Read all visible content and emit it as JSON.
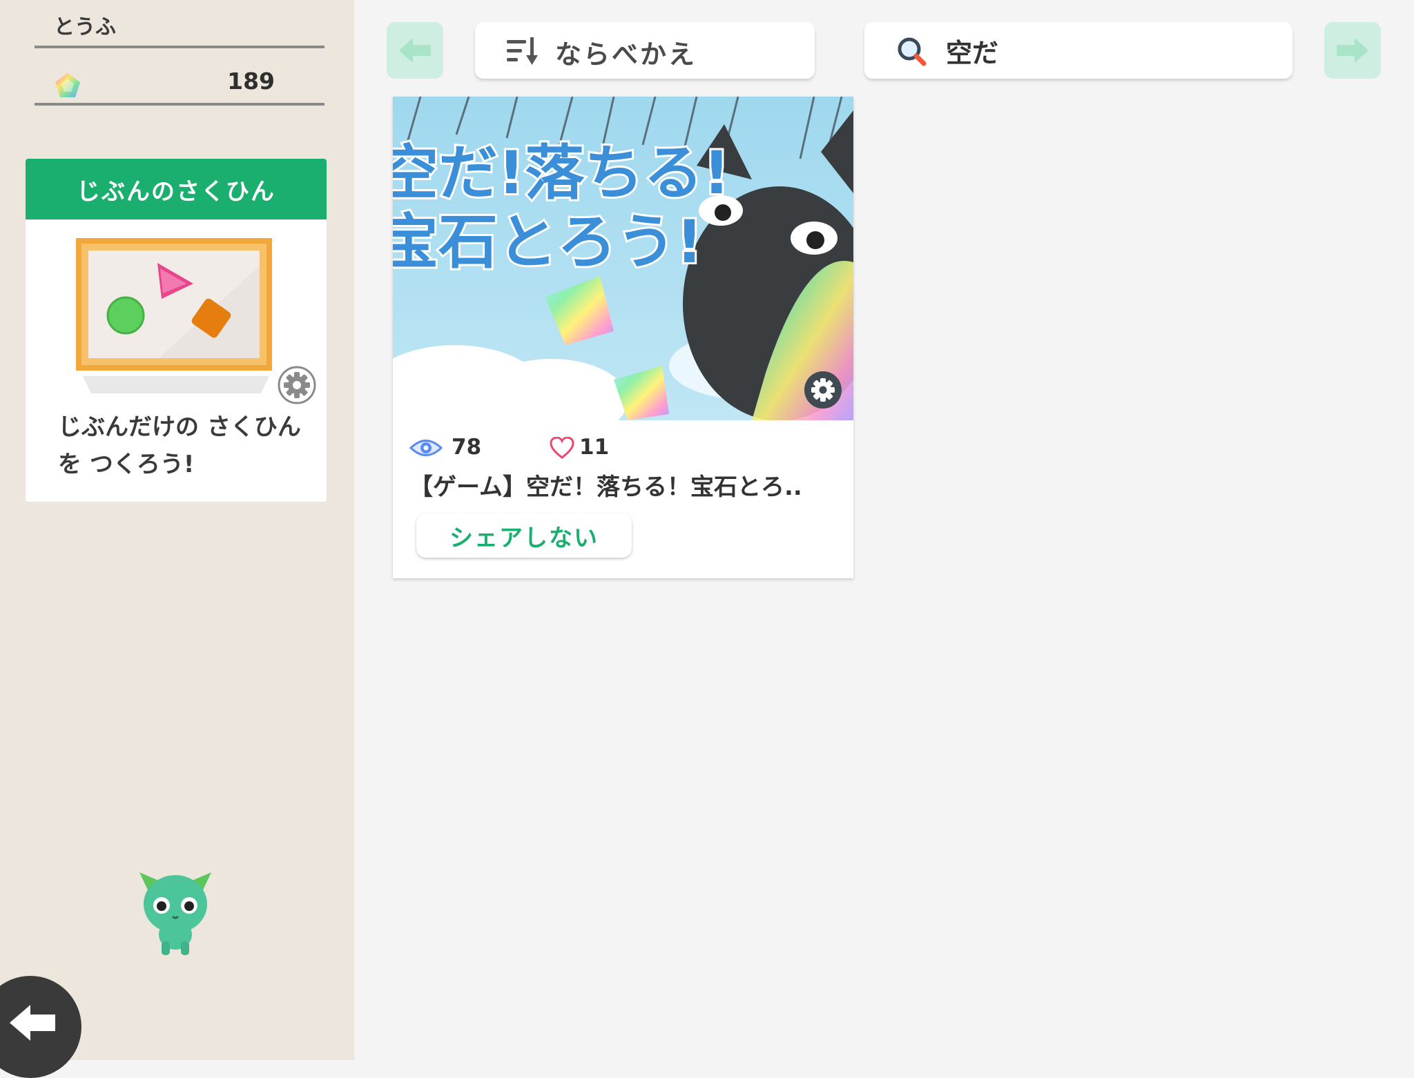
{
  "user": {
    "name": "とうふ",
    "gem_count": "189"
  },
  "works": {
    "header": "じぶんのさくひん",
    "description": "じぶんだけの さくひんを つくろう!"
  },
  "toolbar": {
    "sort_label": "ならべかえ",
    "search_value": "空だ"
  },
  "projects": [
    {
      "thumbnail_text_line1": "空だ!落ちる!",
      "thumbnail_text_line2": "宝石とろう!",
      "views": "78",
      "likes": "11",
      "title": "【ゲーム】空だ！落ちる！宝石とろ..",
      "share_label": "シェアしない"
    }
  ],
  "colors": {
    "accent_green": "#1aaf6e",
    "sidebar_bg": "#ede6dc",
    "nav_arrow_disabled": "#cdeee0",
    "back_button": "#3a3a3a"
  },
  "icons": [
    "gem-icon",
    "gear-icon",
    "sort-icon",
    "search-icon",
    "eye-icon",
    "heart-icon",
    "back-arrow-icon",
    "left-arrow-icon",
    "right-arrow-icon",
    "mascot-icon"
  ]
}
